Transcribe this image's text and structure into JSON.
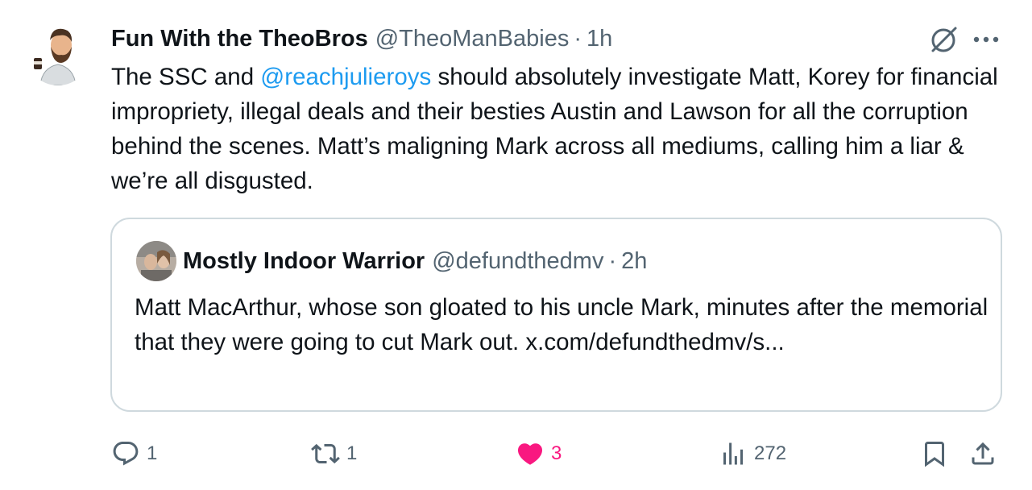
{
  "tweet": {
    "author_name": "Fun With the TheoBros",
    "author_handle": "@TheoManBabies",
    "separator": "·",
    "time": "1h",
    "text_part1": "The SSC and ",
    "mention": "@reachjulieroys",
    "text_part2": " should absolutely investigate Matt, Korey for financial impropriety, illegal deals and their besties Austin and Lawson for all the corruption behind the scenes. Matt’s maligning Mark across all mediums, calling him a liar & we’re all disgusted."
  },
  "quote": {
    "author_name": "Mostly Indoor Warrior",
    "author_handle": "@defundthedmv",
    "separator": "·",
    "time": "2h",
    "text": "Matt MacArthur, whose son gloated to his uncle Mark, minutes after the memorial that they were going to cut Mark out. x.com/defundthedmv/s..."
  },
  "actions": {
    "replies": "1",
    "reposts": "1",
    "likes": "3",
    "views": "272"
  },
  "colors": {
    "accent": "#1d9bf0",
    "like": "#f91880",
    "muted": "#536471",
    "border": "#cfd9de"
  },
  "icons": [
    "grok-icon",
    "more-icon",
    "reply-icon",
    "repost-icon",
    "like-icon",
    "views-icon",
    "bookmark-icon",
    "share-icon"
  ]
}
